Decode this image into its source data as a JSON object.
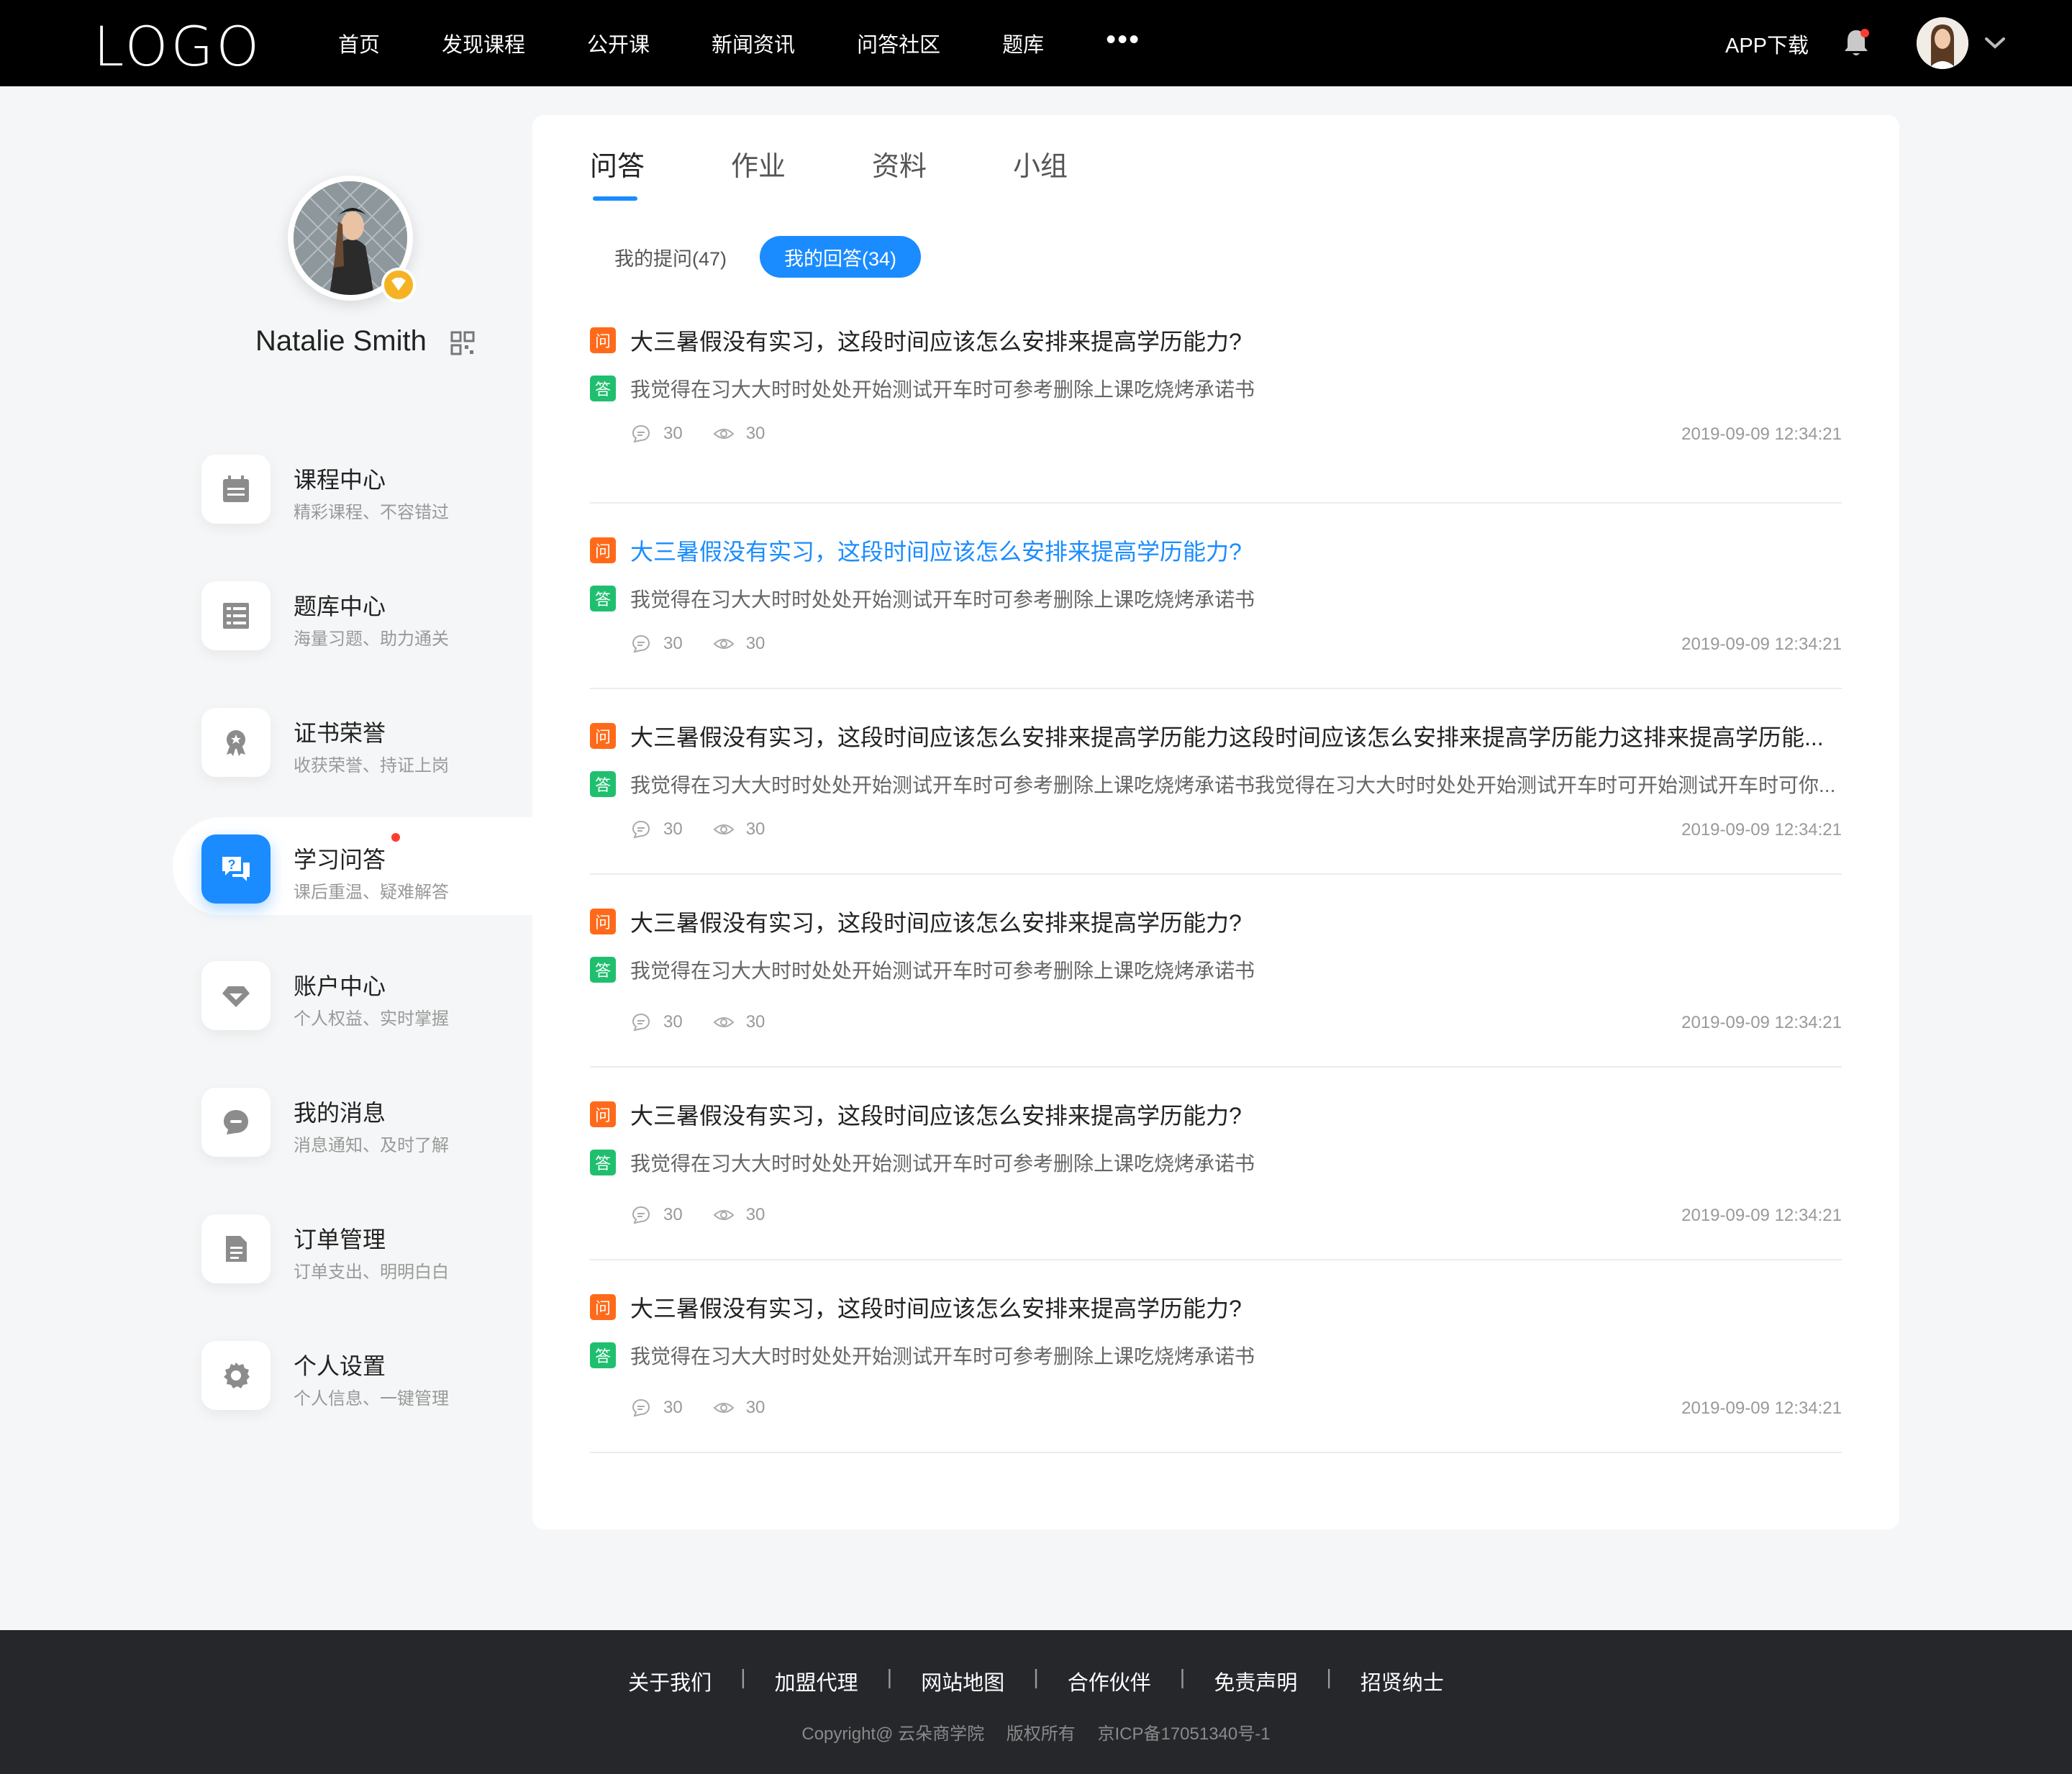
{
  "header": {
    "logo": "LOGO",
    "nav": [
      "首页",
      "发现课程",
      "公开课",
      "新闻资讯",
      "问答社区",
      "题库"
    ],
    "more": "•••",
    "app_download": "APP下载"
  },
  "profile": {
    "name": "Natalie Smith"
  },
  "menu": [
    {
      "title": "课程中心",
      "sub": "精彩课程、不容错过",
      "icon": "calendar-icon"
    },
    {
      "title": "题库中心",
      "sub": "海量习题、助力通关",
      "icon": "list-icon"
    },
    {
      "title": "证书荣誉",
      "sub": "收获荣誉、持证上岗",
      "icon": "award-icon"
    },
    {
      "title": "学习问答",
      "sub": "课后重温、疑难解答",
      "icon": "qa-icon"
    },
    {
      "title": "账户中心",
      "sub": "个人权益、实时掌握",
      "icon": "diamond-icon"
    },
    {
      "title": "我的消息",
      "sub": "消息通知、及时了解",
      "icon": "message-icon"
    },
    {
      "title": "订单管理",
      "sub": "订单支出、明明白白",
      "icon": "document-icon"
    },
    {
      "title": "个人设置",
      "sub": "个人信息、一键管理",
      "icon": "gear-icon"
    }
  ],
  "tabs": [
    "问答",
    "作业",
    "资料",
    "小组"
  ],
  "pills": [
    "我的提问(47)",
    "我的回答(34)"
  ],
  "qa_tags": {
    "question": "问",
    "answer": "答"
  },
  "qa_items": [
    {
      "question": "大三暑假没有实习，这段时间应该怎么安排来提高学历能力?",
      "answer": "我觉得在习大大时时处处开始测试开车时可参考删除上课吃烧烤承诺书",
      "comments": "30",
      "views": "30",
      "date": "2019-09-09 12:34:21"
    },
    {
      "question": "大三暑假没有实习，这段时间应该怎么安排来提高学历能力?",
      "answer": "我觉得在习大大时时处处开始测试开车时可参考删除上课吃烧烤承诺书",
      "comments": "30",
      "views": "30",
      "date": "2019-09-09 12:34:21"
    },
    {
      "question": "大三暑假没有实习，这段时间应该怎么安排来提高学历能力这段时间应该怎么安排来提高学历能力这排来提高学历能...",
      "answer": "我觉得在习大大时时处处开始测试开车时可参考删除上课吃烧烤承诺书我觉得在习大大时时处处开始测试开车时可开始测试开车时可你...",
      "comments": "30",
      "views": "30",
      "date": "2019-09-09 12:34:21"
    },
    {
      "question": "大三暑假没有实习，这段时间应该怎么安排来提高学历能力?",
      "answer": "我觉得在习大大时时处处开始测试开车时可参考删除上课吃烧烤承诺书",
      "comments": "30",
      "views": "30",
      "date": "2019-09-09 12:34:21"
    },
    {
      "question": "大三暑假没有实习，这段时间应该怎么安排来提高学历能力?",
      "answer": "我觉得在习大大时时处处开始测试开车时可参考删除上课吃烧烤承诺书",
      "comments": "30",
      "views": "30",
      "date": "2019-09-09 12:34:21"
    },
    {
      "question": "大三暑假没有实习，这段时间应该怎么安排来提高学历能力?",
      "answer": "我觉得在习大大时时处处开始测试开车时可参考删除上课吃烧烤承诺书",
      "comments": "30",
      "views": "30",
      "date": "2019-09-09 12:34:21"
    }
  ],
  "footer": {
    "links": [
      "关于我们",
      "加盟代理",
      "网站地图",
      "合作伙伴",
      "免责声明",
      "招贤纳士"
    ],
    "separator": "|",
    "copyright": "Copyright@ 云朵商学院",
    "rights": "版权所有",
    "icp": "京ICP备17051340号-1"
  },
  "colors": {
    "accent": "#1a8cff",
    "question_tag": "#ff6a1a",
    "answer_tag": "#1fbf6f",
    "header_bg": "#000000",
    "footer_bg": "#25272b",
    "notification_dot": "#ff3b30"
  }
}
